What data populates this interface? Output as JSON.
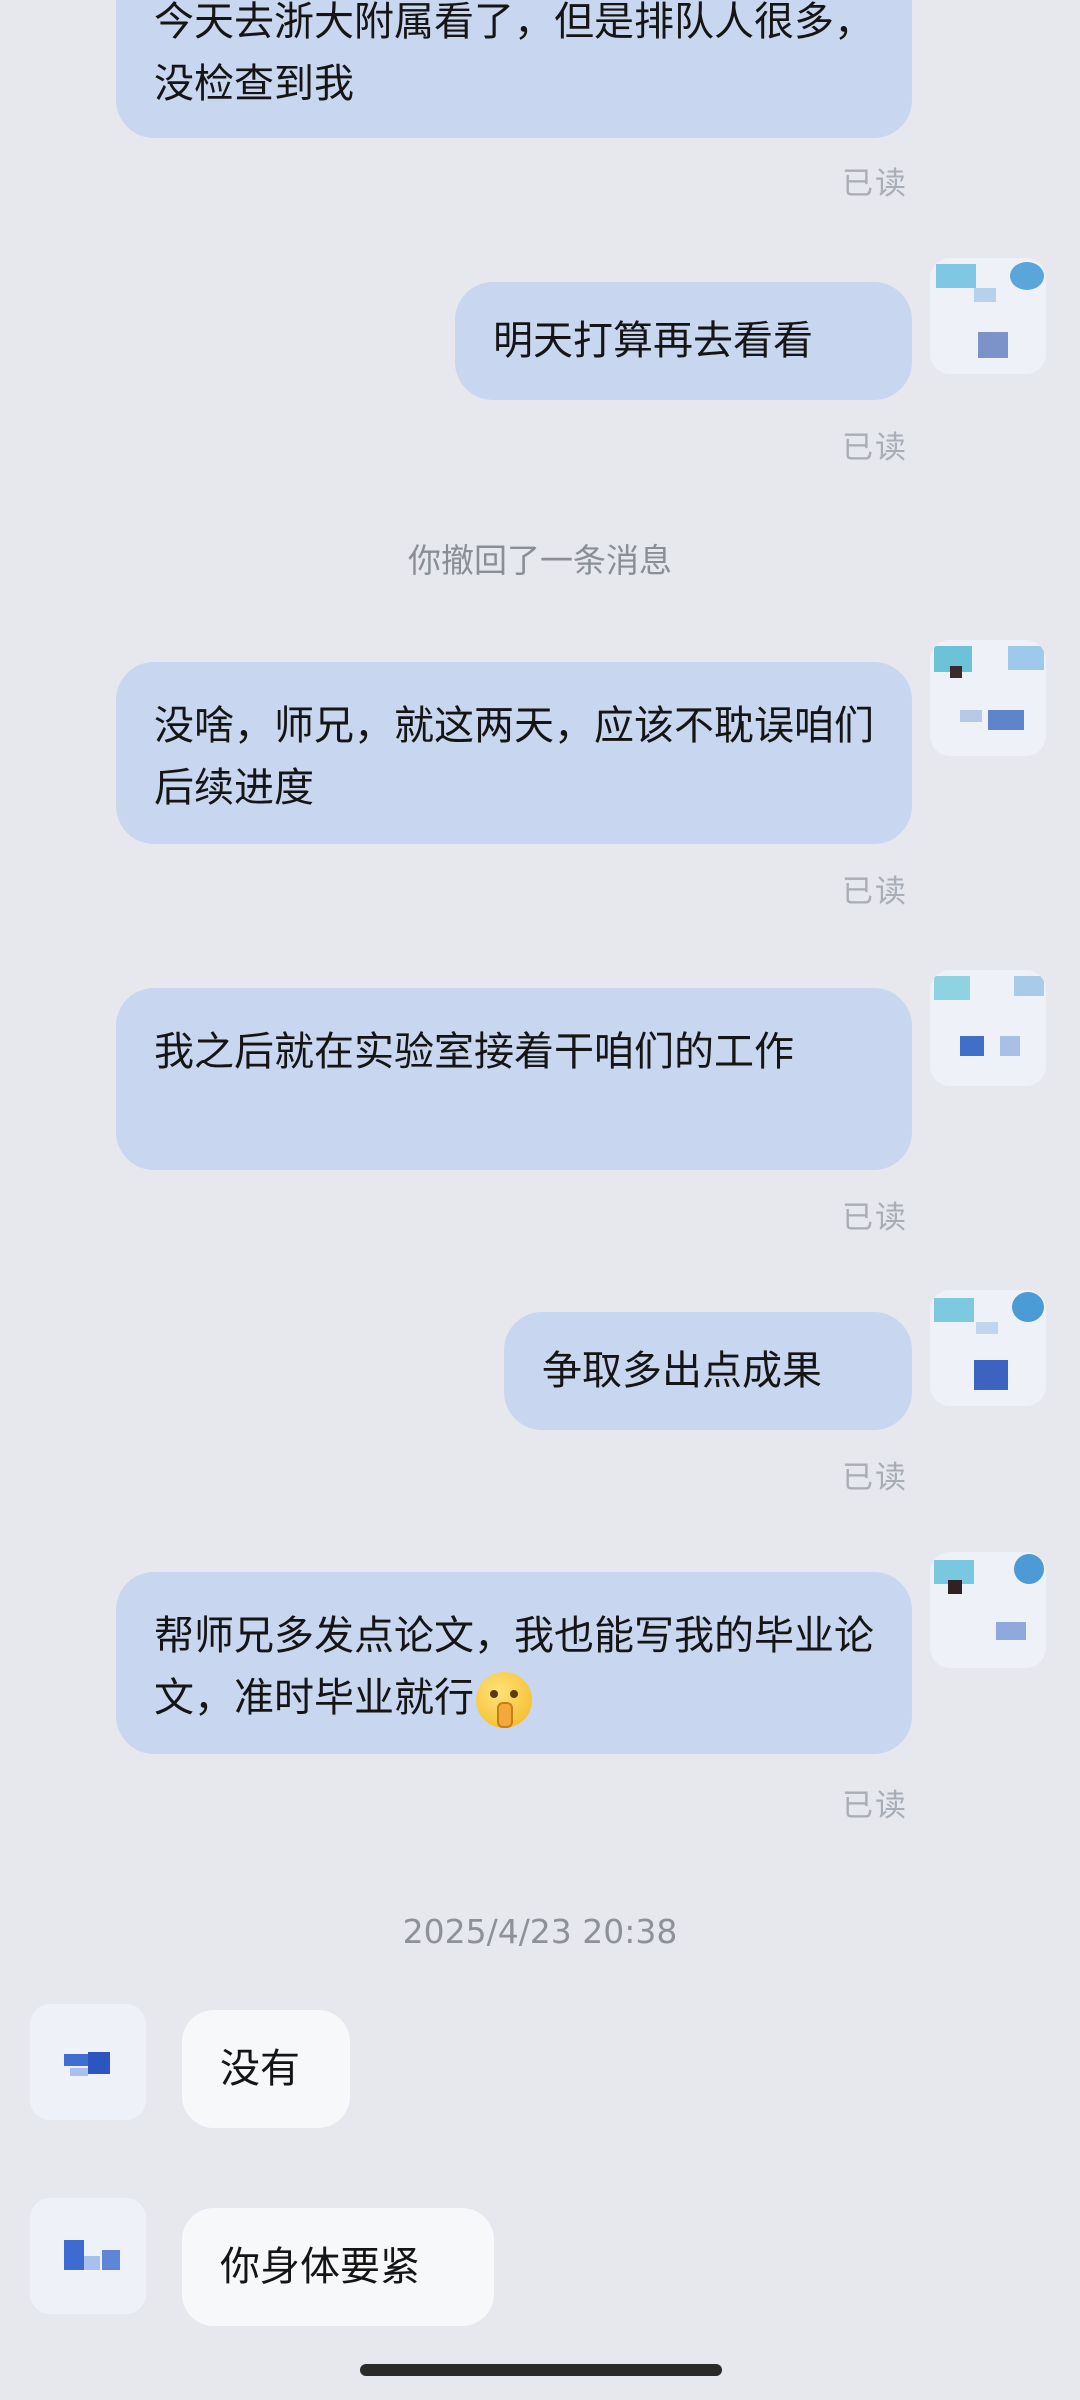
{
  "messages": [
    {
      "text": "今天去浙大附属看了，但是排队人很多，没检查到我",
      "status": "已读"
    },
    {
      "text": "明天打算再去看看",
      "status": "已读"
    },
    {
      "text": "没啥，师兄，就这两天，应该不耽误咱们后续进度",
      "status": "已读"
    },
    {
      "text": "我之后就在实验室接着干咱们的工作",
      "status": "已读"
    },
    {
      "text": "争取多出点成果",
      "status": "已读"
    },
    {
      "text": "帮师兄多发点论文，我也能写我的毕业论文，准时毕业就行",
      "status": "已读",
      "emoji": "shushing-face-emoji"
    }
  ],
  "recall_notice": "你撤回了一条消息",
  "timestamp": "2025/4/23 20:38",
  "incoming": [
    {
      "text": "没有"
    },
    {
      "text": "你身体要紧"
    }
  ],
  "colors": {
    "background": "#e6e8ee",
    "outgoing_bubble": "#c9d6f0",
    "incoming_bubble": "#f7f8fa",
    "read_text": "#a9adb6",
    "notice_text": "#8a8e96"
  }
}
